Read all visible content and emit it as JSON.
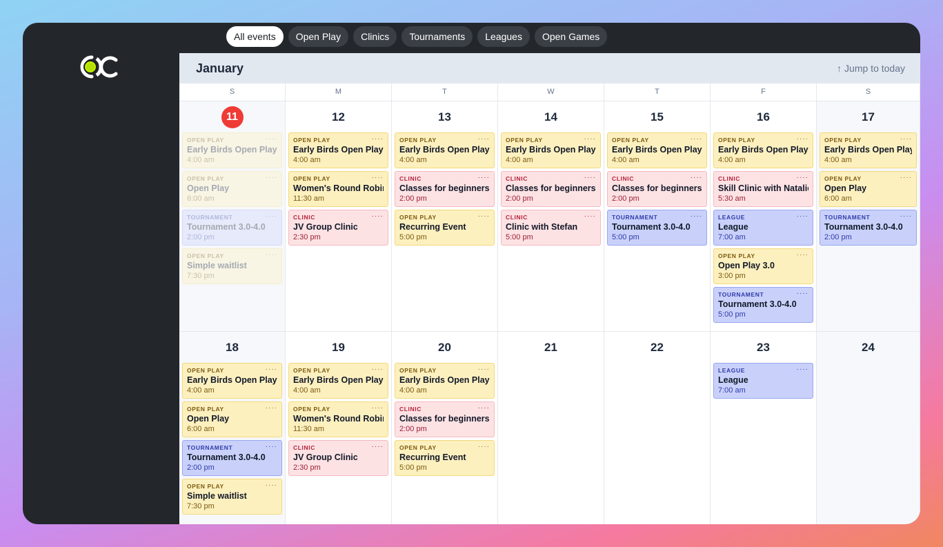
{
  "filters": [
    "All events",
    "Open Play",
    "Clinics",
    "Tournaments",
    "Leagues",
    "Open Games"
  ],
  "active_filter": "All events",
  "month": "January",
  "jump_label": "↑ Jump to today",
  "weekdays": [
    "S",
    "M",
    "T",
    "W",
    "T",
    "F",
    "S"
  ],
  "colors": {
    "open_play": "#fdf0bf",
    "clinic": "#fde2e4",
    "tournament": "#c9d1fb",
    "league": "#c9d1fb",
    "today": "#ef3b36"
  },
  "weeks": [
    [
      {
        "day": "11",
        "today": true,
        "events": [
          {
            "type": "open",
            "cat": "OPEN PLAY",
            "title": "Early Birds Open Play",
            "time": "4:00 am",
            "past": true
          },
          {
            "type": "open",
            "cat": "OPEN PLAY",
            "title": "Open Play",
            "time": "6:00 am",
            "past": true
          },
          {
            "type": "tourn",
            "cat": "TOURNAMENT",
            "title": "Tournament 3.0-4.0",
            "time": "2:00 pm",
            "past": true
          },
          {
            "type": "open",
            "cat": "OPEN PLAY",
            "title": "Simple waitlist",
            "time": "7:30 pm",
            "past": true
          }
        ]
      },
      {
        "day": "12",
        "events": [
          {
            "type": "open",
            "cat": "OPEN PLAY",
            "title": "Early Birds Open Play",
            "time": "4:00 am"
          },
          {
            "type": "open",
            "cat": "OPEN PLAY",
            "title": "Women's Round Robin",
            "time": "11:30 am"
          },
          {
            "type": "clinic",
            "cat": "CLINIC",
            "title": "JV Group Clinic",
            "time": "2:30 pm"
          }
        ]
      },
      {
        "day": "13",
        "events": [
          {
            "type": "open",
            "cat": "OPEN PLAY",
            "title": "Early Birds Open Play",
            "time": "4:00 am"
          },
          {
            "type": "clinic",
            "cat": "CLINIC",
            "title": "Classes for beginners",
            "time": "2:00 pm"
          },
          {
            "type": "open",
            "cat": "OPEN PLAY",
            "title": "Recurring Event",
            "time": "5:00 pm"
          }
        ]
      },
      {
        "day": "14",
        "events": [
          {
            "type": "open",
            "cat": "OPEN PLAY",
            "title": "Early Birds Open Play",
            "time": "4:00 am"
          },
          {
            "type": "clinic",
            "cat": "CLINIC",
            "title": "Classes for beginners",
            "time": "2:00 pm"
          },
          {
            "type": "clinic",
            "cat": "CLINIC",
            "title": "Clinic with Stefan",
            "time": "5:00 pm"
          }
        ]
      },
      {
        "day": "15",
        "events": [
          {
            "type": "open",
            "cat": "OPEN PLAY",
            "title": "Early Birds Open Play",
            "time": "4:00 am"
          },
          {
            "type": "clinic",
            "cat": "CLINIC",
            "title": "Classes for beginners",
            "time": "2:00 pm"
          },
          {
            "type": "tourn",
            "cat": "TOURNAMENT",
            "title": "Tournament 3.0-4.0",
            "time": "5:00 pm"
          }
        ]
      },
      {
        "day": "16",
        "events": [
          {
            "type": "open",
            "cat": "OPEN PLAY",
            "title": "Early Birds Open Play",
            "time": "4:00 am"
          },
          {
            "type": "clinic",
            "cat": "CLINIC",
            "title": "Skill Clinic with Natalie",
            "time": "5:30 am"
          },
          {
            "type": "league",
            "cat": "LEAGUE",
            "title": "League",
            "time": "7:00 am"
          },
          {
            "type": "open",
            "cat": "OPEN PLAY",
            "title": "Open Play 3.0",
            "time": "3:00 pm"
          },
          {
            "type": "tourn",
            "cat": "TOURNAMENT",
            "title": "Tournament 3.0-4.0",
            "time": "5:00 pm"
          }
        ]
      },
      {
        "day": "17",
        "events": [
          {
            "type": "open",
            "cat": "OPEN PLAY",
            "title": "Early Birds Open Play",
            "time": "4:00 am"
          },
          {
            "type": "open",
            "cat": "OPEN PLAY",
            "title": "Open Play",
            "time": "6:00 am"
          },
          {
            "type": "tourn",
            "cat": "TOURNAMENT",
            "title": "Tournament 3.0-4.0",
            "time": "2:00 pm"
          }
        ]
      }
    ],
    [
      {
        "day": "18",
        "events": [
          {
            "type": "open",
            "cat": "OPEN PLAY",
            "title": "Early Birds Open Play",
            "time": "4:00 am"
          },
          {
            "type": "open",
            "cat": "OPEN PLAY",
            "title": "Open Play",
            "time": "6:00 am"
          },
          {
            "type": "tourn",
            "cat": "TOURNAMENT",
            "title": "Tournament 3.0-4.0",
            "time": "2:00 pm"
          },
          {
            "type": "open",
            "cat": "OPEN PLAY",
            "title": "Simple waitlist",
            "time": "7:30 pm"
          }
        ]
      },
      {
        "day": "19",
        "events": [
          {
            "type": "open",
            "cat": "OPEN PLAY",
            "title": "Early Birds Open Play",
            "time": "4:00 am"
          },
          {
            "type": "open",
            "cat": "OPEN PLAY",
            "title": "Women's Round Robin",
            "time": "11:30 am"
          },
          {
            "type": "clinic",
            "cat": "CLINIC",
            "title": "JV Group Clinic",
            "time": "2:30 pm"
          }
        ]
      },
      {
        "day": "20",
        "events": [
          {
            "type": "open",
            "cat": "OPEN PLAY",
            "title": "Early Birds Open Play",
            "time": "4:00 am"
          },
          {
            "type": "clinic",
            "cat": "CLINIC",
            "title": "Classes for beginners",
            "time": "2:00 pm"
          },
          {
            "type": "open",
            "cat": "OPEN PLAY",
            "title": "Recurring Event",
            "time": "5:00 pm"
          }
        ]
      },
      {
        "day": "21",
        "events": []
      },
      {
        "day": "22",
        "events": []
      },
      {
        "day": "23",
        "events": [
          {
            "type": "league",
            "cat": "LEAGUE",
            "title": "League",
            "time": "7:00 am"
          }
        ]
      },
      {
        "day": "24",
        "events": []
      }
    ]
  ]
}
